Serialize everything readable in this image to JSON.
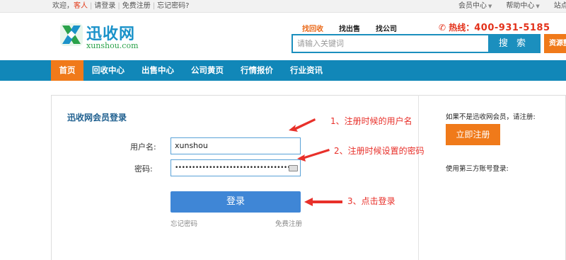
{
  "topbar": {
    "welcome": "欢迎，",
    "guest": "客人",
    "login": "请登录",
    "register": "免费注册",
    "forgot": "忘记密码?",
    "member_center": "会员中心",
    "help_center": "帮助中心",
    "site_nav": "站点导航"
  },
  "logo": {
    "name_cn": "迅收网",
    "name_en": "xunshou.com"
  },
  "search": {
    "tabs": [
      {
        "label": "找回收",
        "active": true
      },
      {
        "label": "找出售",
        "active": false
      },
      {
        "label": "找公司",
        "active": false
      }
    ],
    "placeholder": "请输入关键词",
    "button": "搜 索",
    "resource_button": "资源整合"
  },
  "hotline": {
    "label": "热线：",
    "number": "400-931-5185"
  },
  "nav": {
    "items": [
      {
        "label": "首页",
        "active": true
      },
      {
        "label": "回收中心",
        "active": false
      },
      {
        "label": "出售中心",
        "active": false
      },
      {
        "label": "公司黄页",
        "active": false
      },
      {
        "label": "行情报价",
        "active": false
      },
      {
        "label": "行业资讯",
        "active": false
      }
    ]
  },
  "login": {
    "title": "迅收网会员登录",
    "username_label": "用户名:",
    "username_value": "xunshou",
    "password_label": "密码:",
    "password_value": "••••••••••••••••••••••••••••••••••",
    "submit": "登录",
    "forgot": "忘记密码",
    "free_register": "免费注册"
  },
  "annotations": {
    "note1": "1、注册时候的用户名",
    "note2": "2、注册时候设置的密码",
    "note3": "3、点击登录"
  },
  "sidebar": {
    "hint": "如果不是迅收网会员，请注册:",
    "register_button": "立即注册",
    "third_party": "使用第三方账号登录:"
  },
  "colors": {
    "brand_blue": "#1187b8",
    "accent_orange": "#f07a1a",
    "annotation_red": "#e8302a",
    "login_blue": "#3f86d6"
  }
}
